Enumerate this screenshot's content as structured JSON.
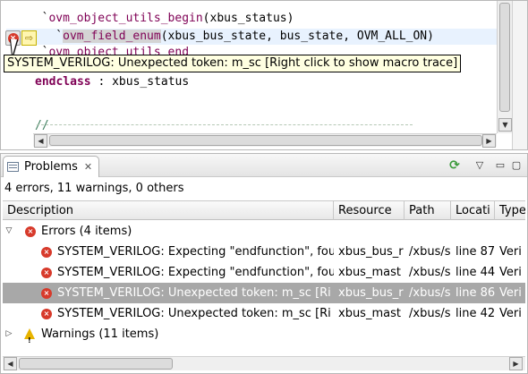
{
  "editor": {
    "lines": [
      {
        "prefix": "  `",
        "macro": "ovm_object_utils_begin",
        "rest": "(xbus_status)"
      },
      {
        "prefix": "    `",
        "macro": "ovm_field_enum",
        "rest": "(xbus_bus_state, bus_state, OVM_ALL_ON)"
      },
      {
        "prefix": "  `",
        "macro": "ovm_object_utils_end",
        "rest": ""
      },
      {
        "keyword": "endclass",
        "rest": " : xbus_status"
      },
      {
        "comment": "//"
      }
    ],
    "error_marker_glyph": "×",
    "quickfix_glyph": "⇨",
    "tooltip": "SYSTEM_VERILOG: Unexpected token: m_sc [Right click to show macro trace]"
  },
  "problems": {
    "tab_label": "Problems",
    "tab_close": "✕",
    "toolbar": {
      "filter_icon": "⟳",
      "menu_icon": "▽",
      "minimize_icon": "▭",
      "maximize_icon": "▢"
    },
    "summary": "4 errors, 11 warnings, 0 others",
    "columns": [
      "Description",
      "Resource",
      "Path",
      "Locati",
      "Type"
    ],
    "groups": [
      {
        "label": "Errors (4 items)",
        "expanded": true,
        "expander": "▽",
        "icon": "error-icon"
      },
      {
        "label": "Warnings (11 items)",
        "expanded": false,
        "expander": "▷",
        "icon": "warning-icon"
      }
    ],
    "rows": [
      {
        "description": "SYSTEM_VERILOG: Expecting \"endfunction\", fou",
        "resource": "xbus_bus_r",
        "path": "/xbus/s",
        "location": "line 87",
        "type": "Veri"
      },
      {
        "description": "SYSTEM_VERILOG: Expecting \"endfunction\", fou",
        "resource": "xbus_mast",
        "path": "/xbus/s",
        "location": "line 44",
        "type": "Veri"
      },
      {
        "description": "SYSTEM_VERILOG: Unexpected token: m_sc [Ri",
        "resource": "xbus_bus_r",
        "path": "/xbus/s",
        "location": "line 86",
        "type": "Veri",
        "selected": true
      },
      {
        "description": "SYSTEM_VERILOG: Unexpected token: m_sc [Ri",
        "resource": "xbus_mast",
        "path": "/xbus/s",
        "location": "line 42",
        "type": "Veri"
      }
    ]
  },
  "scrollbars": {
    "left_arrow": "◀",
    "right_arrow": "▶",
    "up_arrow": "▲",
    "down_arrow": "▼"
  }
}
